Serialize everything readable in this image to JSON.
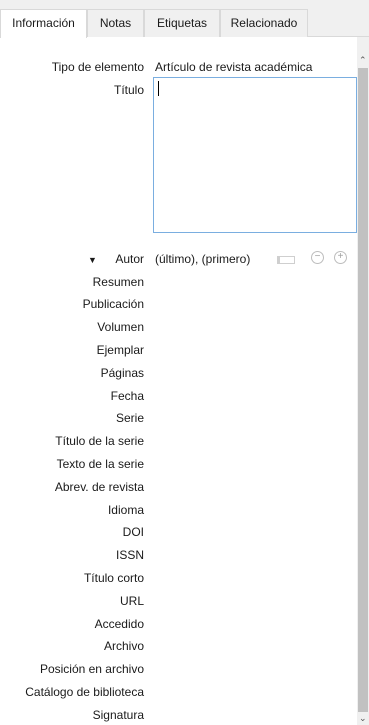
{
  "tabs": [
    {
      "label": "Información"
    },
    {
      "label": "Notas"
    },
    {
      "label": "Etiquetas"
    },
    {
      "label": "Relacionado"
    }
  ],
  "fields": {
    "item_type_label": "Tipo de elemento",
    "item_type_value": "Artículo de revista académica",
    "title_label": "Título",
    "author_label": "Autor",
    "author_value": "(último), (primero)",
    "rows": [
      "Resumen",
      "Publicación",
      "Volumen",
      "Ejemplar",
      "Páginas",
      "Fecha",
      "Serie",
      "Título de la serie",
      "Texto de la serie",
      "Abrev. de revista",
      "Idioma",
      "DOI",
      "ISSN",
      "Título corto",
      "URL",
      "Accedido",
      "Archivo",
      "Posición en archivo",
      "Catálogo de biblioteca",
      "Signatura"
    ]
  },
  "icons": {
    "twisty": "triangle-down",
    "remove": "minus-circle",
    "add": "plus-circle",
    "scroll_up": "chevron-up",
    "scroll_down": "chevron-down"
  }
}
